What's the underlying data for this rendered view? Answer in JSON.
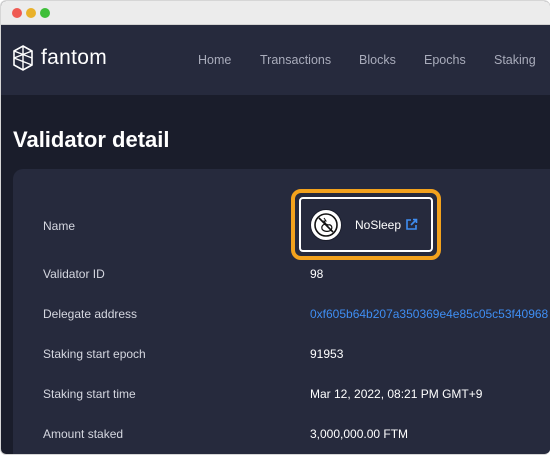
{
  "nav": {
    "logo_text": "fantom",
    "items": [
      "Home",
      "Transactions",
      "Blocks",
      "Epochs",
      "Staking"
    ]
  },
  "page": {
    "title": "Validator detail"
  },
  "validator": {
    "name_label": "Name",
    "name_value": "NoSleep",
    "rows": [
      {
        "label": "Validator ID",
        "value": "98"
      },
      {
        "label": "Delegate address",
        "value": "0xf605b64b207a350369e4e85c05c53f40968"
      },
      {
        "label": "Staking start epoch",
        "value": "91953"
      },
      {
        "label": "Staking start time",
        "value": "Mar 12, 2022, 08:21 PM GMT+9"
      },
      {
        "label": "Amount staked",
        "value": "3,000,000.00 FTM"
      }
    ]
  },
  "icons": {
    "logo": "fantom-logo-icon",
    "avatar": "validator-avatar-icon",
    "external": "external-link-icon"
  },
  "colors": {
    "background": "#1a1d2b",
    "panel": "#262a3d",
    "link": "#3f8ef3",
    "highlight": "#f3a21d"
  }
}
